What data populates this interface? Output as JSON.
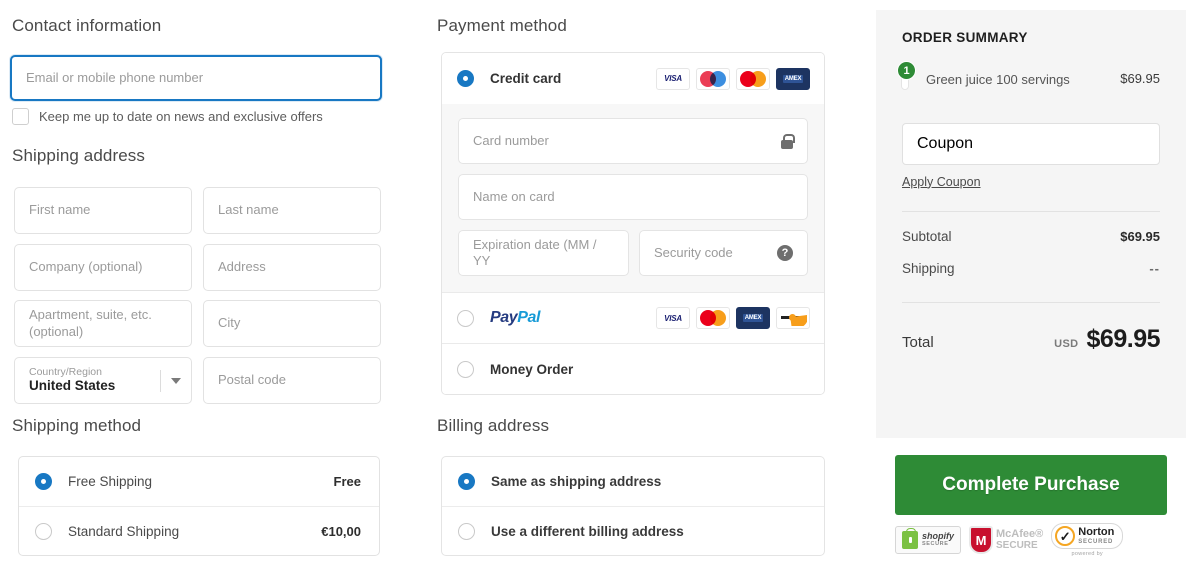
{
  "contact": {
    "title": "Contact information",
    "email_placeholder": "Email or mobile phone number",
    "email_value": "",
    "newsletter_label": "Keep me up to date on news and exclusive offers"
  },
  "shipping_address": {
    "title": "Shipping address",
    "fields": [
      {
        "name": "first-name",
        "placeholder": "First name",
        "value": ""
      },
      {
        "name": "last-name",
        "placeholder": "Last name",
        "value": ""
      },
      {
        "name": "company",
        "placeholder": "Company (optional)",
        "value": ""
      },
      {
        "name": "address",
        "placeholder": "Address",
        "value": ""
      },
      {
        "name": "apartment",
        "placeholder": "Apartment, suite, etc. (optional)",
        "value": ""
      },
      {
        "name": "city",
        "placeholder": "City",
        "value": ""
      },
      {
        "name": "postal-code",
        "placeholder": "Postal code",
        "value": ""
      }
    ],
    "country": {
      "label": "Country/Region",
      "value": "United States"
    }
  },
  "shipping_method": {
    "title": "Shipping method",
    "options": [
      {
        "label": "Free Shipping",
        "price": "Free",
        "selected": true
      },
      {
        "label": "Standard Shipping",
        "price": "€10,00",
        "selected": false
      }
    ]
  },
  "payment": {
    "title": "Payment method",
    "credit_card": {
      "label": "Credit card",
      "selected": true,
      "accepted_icons": [
        "visa-icon",
        "maestro-icon",
        "mastercard-icon",
        "amex-icon"
      ],
      "fields": {
        "card_number_placeholder": "Card number",
        "name_on_card_placeholder": "Name on card",
        "expiration_placeholder": "Expiration date (MM / YY",
        "security_code_placeholder": "Security code"
      }
    },
    "paypal": {
      "label_a": "Pay",
      "label_b": "Pal",
      "selected": false,
      "accepted_icons": [
        "visa-icon",
        "mastercard-icon",
        "amex-icon",
        "discover-icon"
      ]
    },
    "money_order": {
      "label": "Money Order",
      "selected": false
    }
  },
  "billing": {
    "title": "Billing address",
    "options": [
      {
        "label": "Same as shipping address",
        "selected": true
      },
      {
        "label": "Use a different billing address",
        "selected": false
      }
    ]
  },
  "order_summary": {
    "heading": "ORDER SUMMARY",
    "product": {
      "name": "Green juice 100 servings",
      "price": "$69.95",
      "quantity": "1"
    },
    "coupon_placeholder": "Coupon",
    "coupon_value": "",
    "apply_coupon_label": "Apply Coupon",
    "lines": [
      {
        "label": "Subtotal",
        "value": "$69.95"
      },
      {
        "label": "Shipping",
        "value": "--"
      }
    ],
    "total_label": "Total",
    "currency": "USD",
    "total_value": "$69.95"
  },
  "cta": {
    "label": "Complete Purchase"
  },
  "trust_badges": {
    "shopify": {
      "line1": "shopify",
      "line2": "SECURE"
    },
    "mcafee": {
      "line1": "McAfee®",
      "line2": "SECURE"
    },
    "norton": {
      "line1": "Norton",
      "line2": "SECURED",
      "powered": "powered by"
    }
  },
  "colors": {
    "accent_blue": "#1878c3",
    "cta_green": "#2e8b36",
    "summary_bg": "#f5f5f5",
    "badge_green": "#2e8b36"
  }
}
